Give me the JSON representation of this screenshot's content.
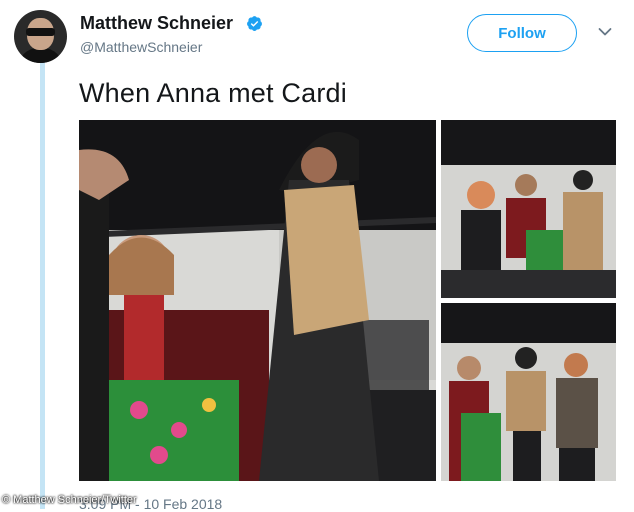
{
  "author": {
    "name": "Matthew Schneier",
    "handle": "@MatthewSchneier",
    "verified": true,
    "avatar_icon": "profile-photo"
  },
  "actions": {
    "follow_label": "Follow",
    "menu_icon": "chevron-down-icon"
  },
  "tweet": {
    "text": "When Anna met Cardi",
    "timestamp": "3:09 PM - 10 Feb 2018"
  },
  "media": {
    "count": 3
  },
  "watermark": {
    "credit": "© Matthew Schneier/Twitter"
  },
  "colors": {
    "accent": "#1da1f2",
    "thread_line": "#c4e4f5",
    "secondary_text": "#657786"
  }
}
